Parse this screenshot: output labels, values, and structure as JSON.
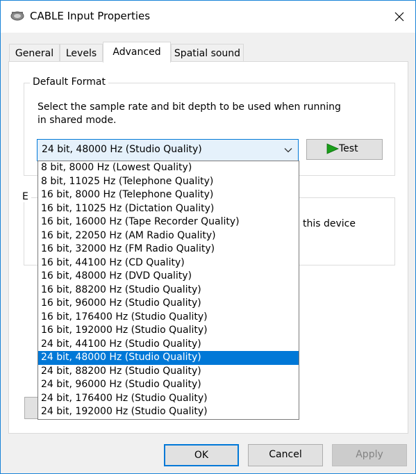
{
  "window": {
    "title": "CABLE Input Properties"
  },
  "tabs": [
    {
      "label": "General"
    },
    {
      "label": "Levels"
    },
    {
      "label": "Advanced"
    },
    {
      "label": "Spatial sound"
    }
  ],
  "default_format": {
    "group_label": "Default Format",
    "description_line1": "Select the sample rate and bit depth to be used when running",
    "description_line2": "in shared mode.",
    "selected_value": "24 bit, 48000 Hz (Studio Quality)",
    "test_label": "Test",
    "options": [
      "8 bit, 8000 Hz (Lowest Quality)",
      "8 bit, 11025 Hz (Telephone Quality)",
      "16 bit, 8000 Hz (Telephone Quality)",
      "16 bit, 11025 Hz (Dictation Quality)",
      "16 bit, 16000 Hz (Tape Recorder Quality)",
      "16 bit, 22050 Hz (AM Radio Quality)",
      "16 bit, 32000 Hz (FM Radio Quality)",
      "16 bit, 44100 Hz (CD Quality)",
      "16 bit, 48000 Hz (DVD Quality)",
      "16 bit, 88200 Hz (Studio Quality)",
      "16 bit, 96000 Hz (Studio Quality)",
      "16 bit, 176400 Hz (Studio Quality)",
      "16 bit, 192000 Hz (Studio Quality)",
      "24 bit, 44100 Hz (Studio Quality)",
      "24 bit, 48000 Hz (Studio Quality)",
      "24 bit, 88200 Hz (Studio Quality)",
      "24 bit, 96000 Hz (Studio Quality)",
      "24 bit, 176400 Hz (Studio Quality)",
      "24 bit, 192000 Hz (Studio Quality)"
    ],
    "selected_index": 14
  },
  "exclusive_mode": {
    "group_label_fragment": "E",
    "text_fragment": "this device"
  },
  "buttons": {
    "ok": "OK",
    "cancel": "Cancel",
    "apply": "Apply"
  },
  "colors": {
    "accent": "#0078d7",
    "test_icon": "#1a9e1a"
  }
}
